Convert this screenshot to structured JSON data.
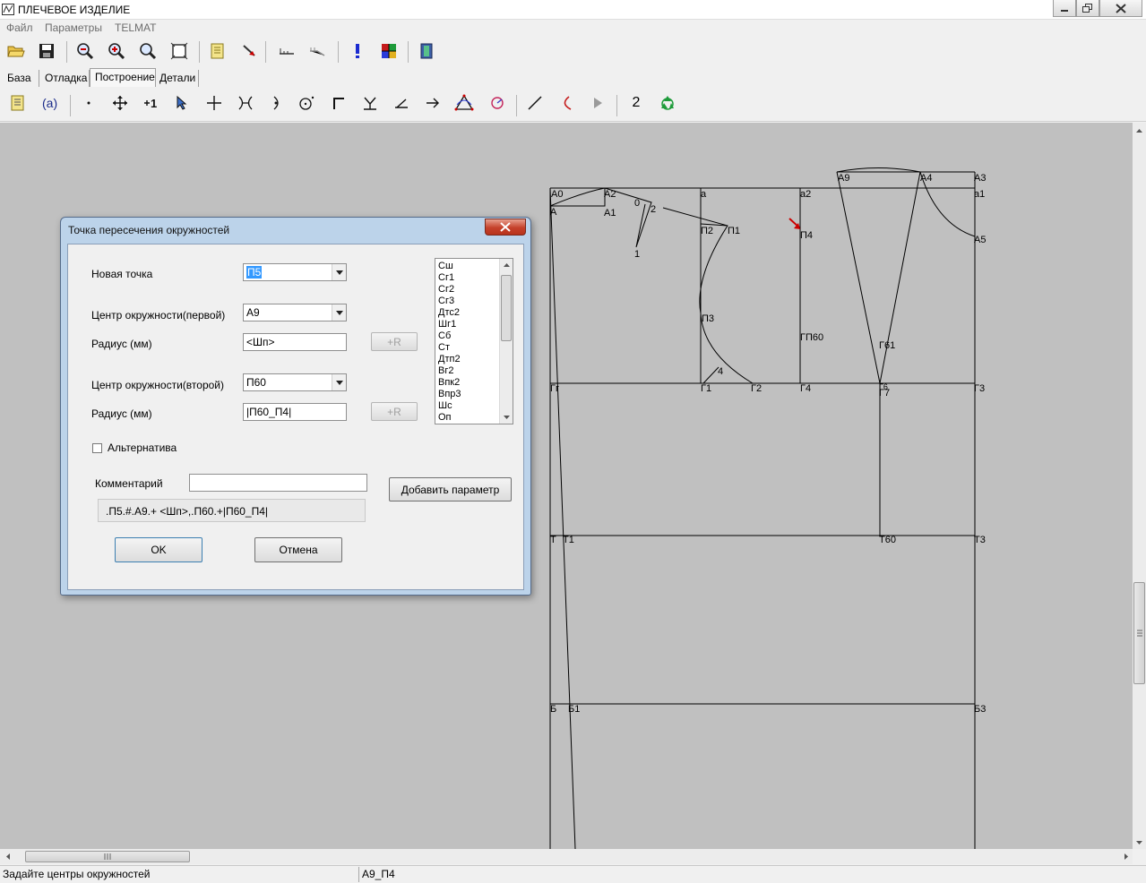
{
  "window": {
    "title": "ПЛЕЧЕВОЕ ИЗДЕЛИЕ"
  },
  "menu": [
    "Файл",
    "Параметры",
    "TELMAT"
  ],
  "tabs": [
    {
      "label": "База"
    },
    {
      "label": "Отладка"
    },
    {
      "label": "Построение"
    },
    {
      "label": "Детали"
    }
  ],
  "toolbar2_text": {
    "num_button": "2"
  },
  "drawing_labels": {
    "A0": "А0",
    "A2": "А2",
    "A": "А",
    "A1": "А1",
    "zero": "0",
    "two": "2",
    "one": "1",
    "a": "а",
    "a2": "а2",
    "P2": "П2",
    "P1": "П1",
    "P4": "П4",
    "P3": "П3",
    "GP60": "ГП60",
    "A9": "А9",
    "A4": "А4",
    "A3": "А3",
    "a1": "а1",
    "A5": "А5",
    "G61": "Г61",
    "four": "4",
    "Gg": "Гг",
    "G1": "Г1",
    "G2": "Г2",
    "G4": "Г4",
    "G7": "Г7",
    "G6": "Г6",
    "G3": "Г3",
    "T": "Т",
    "T1": "Т1",
    "T60": "Т60",
    "T3": "Т3",
    "B": "Б",
    "B1": "Б1",
    "B3": "Б3"
  },
  "dialog": {
    "title": "Точка пересечения окружностей",
    "new_point_label": "Новая точка",
    "new_point_value": "П5",
    "center1_label": "Центр окружности(первой)",
    "center1_value": "А9",
    "radius1_label": "Радиус (мм)",
    "radius1_value": "<Шп>",
    "center2_label": "Центр окружности(второй)",
    "center2_value": "П60",
    "radius2_label": "Радиус (мм)",
    "radius2_value": "|П60_П4|",
    "plus_r": "+R",
    "alt_label": "Альтернатива",
    "alt_checked": false,
    "comment_label": "Комментарий",
    "comment_value": "",
    "add_param": "Добавить параметр",
    "formula": ".П5.#.А9.+ <Шп>,.П60.+|П60_П4|",
    "ok": "OK",
    "cancel": "Отмена",
    "params_list": [
      "Сш",
      "Сг1",
      "Сг2",
      "Сг3",
      "Дтс2",
      "Шг1",
      "Сб",
      "Ст",
      "Дтп2",
      "Вг2",
      "Впк2",
      "Впр3",
      "Шс",
      "Оп"
    ]
  },
  "status": {
    "left": "Задайте центры окружностей",
    "right": "А9_П4"
  },
  "colors": {
    "canvas_bg": "#c0c0c0",
    "dialog_frame": "#bcd3ea",
    "close_btn": "#c5412b",
    "marker": "#cc0000"
  }
}
